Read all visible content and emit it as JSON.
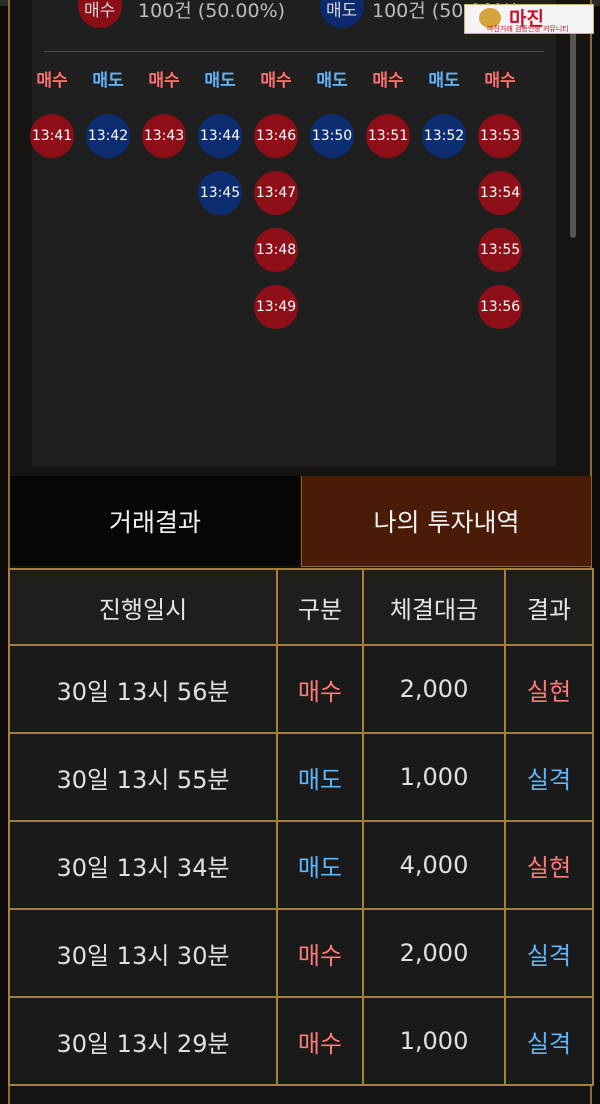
{
  "summary": {
    "buy_label": "매수",
    "buy_text": "100건 (50.00%)",
    "sell_label": "매도",
    "sell_text": "100건 (50.00%)"
  },
  "columns": [
    {
      "type": "buy",
      "header": "매수",
      "times": [
        "13:41"
      ]
    },
    {
      "type": "sell",
      "header": "매도",
      "times": [
        "13:42"
      ]
    },
    {
      "type": "buy",
      "header": "매수",
      "times": [
        "13:43"
      ]
    },
    {
      "type": "sell",
      "header": "매도",
      "times": [
        "13:44",
        "13:45"
      ]
    },
    {
      "type": "buy",
      "header": "매수",
      "times": [
        "13:46",
        "13:47",
        "13:48",
        "13:49"
      ]
    },
    {
      "type": "sell",
      "header": "매도",
      "times": [
        "13:50"
      ]
    },
    {
      "type": "buy",
      "header": "매수",
      "times": [
        "13:51"
      ]
    },
    {
      "type": "sell",
      "header": "매도",
      "times": [
        "13:52"
      ]
    },
    {
      "type": "buy",
      "header": "매수",
      "times": [
        "13:53",
        "13:54",
        "13:55",
        "13:56"
      ]
    }
  ],
  "tabs": {
    "results": "거래결과",
    "my_history": "나의 투자내역"
  },
  "table": {
    "headers": [
      "진행일시",
      "구분",
      "체결대금",
      "결과"
    ],
    "rows": [
      {
        "time": "30일 13시 56분",
        "side": "매수",
        "side_type": "buy",
        "amount": "2,000",
        "result": "실현",
        "result_type": "buy"
      },
      {
        "time": "30일 13시 55분",
        "side": "매도",
        "side_type": "sell",
        "amount": "1,000",
        "result": "실격",
        "result_type": "sell"
      },
      {
        "time": "30일 13시 34분",
        "side": "매도",
        "side_type": "sell",
        "amount": "4,000",
        "result": "실현",
        "result_type": "buy"
      },
      {
        "time": "30일 13시 30분",
        "side": "매수",
        "side_type": "buy",
        "amount": "2,000",
        "result": "실격",
        "result_type": "sell"
      },
      {
        "time": "30일 13시 29분",
        "side": "매수",
        "side_type": "buy",
        "amount": "1,000",
        "result": "실격",
        "result_type": "sell"
      }
    ]
  },
  "logo": {
    "name": "마진",
    "tagline": "마진거래 검증인증 커뮤니티"
  }
}
